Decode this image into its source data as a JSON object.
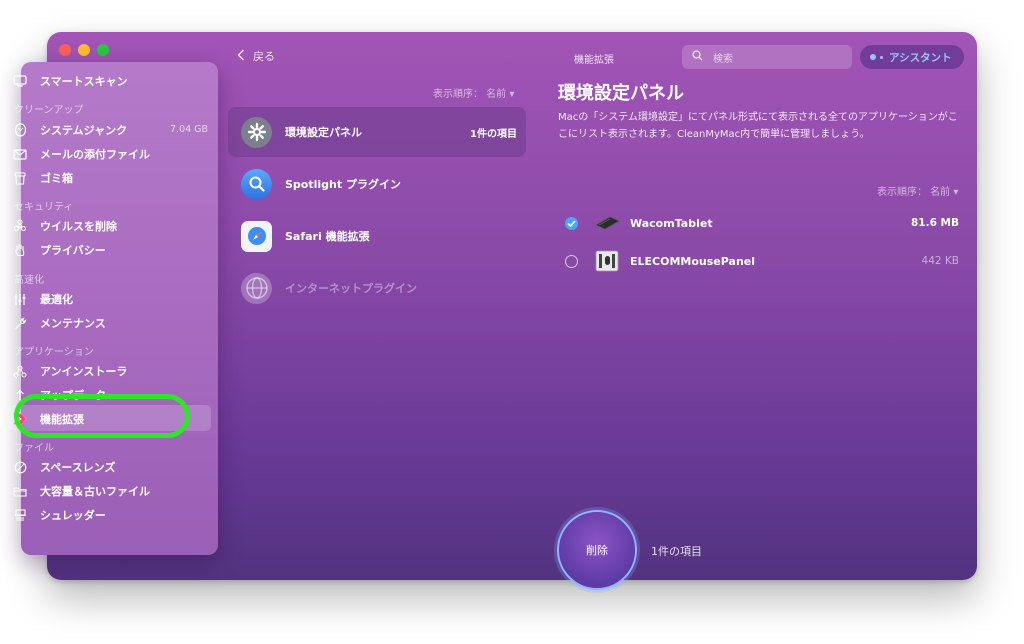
{
  "window": {
    "back_label": "戻る",
    "title": "機能拡張",
    "search_placeholder": "検索",
    "assistant_label": "アシスタント"
  },
  "sidebar": {
    "smart_scan": "スマートスキャン",
    "sections": {
      "cleanup": "クリーンアップ",
      "security": "セキュリティ",
      "speed": "高速化",
      "apps": "アプリケーション",
      "files": "ファイル"
    },
    "items": {
      "system_junk": "システムジャンク",
      "system_junk_size": "7.04 GB",
      "mail_attachments": "メールの添付ファイル",
      "trash": "ゴミ箱",
      "malware": "ウイルスを削除",
      "privacy": "プライバシー",
      "optimization": "最適化",
      "maintenance": "メンテナンス",
      "uninstaller": "アンインストーラ",
      "updater": "アップデータ",
      "extensions": "機能拡張",
      "space_lens": "スペースレンズ",
      "large_old": "大容量＆古いファイル",
      "shredder": "シュレッダー"
    }
  },
  "middle": {
    "sort_label": "表示順序： 名前",
    "categories": [
      {
        "label": "環境設定パネル",
        "count": "1件の項目"
      },
      {
        "label": "Spotlight プラグイン"
      },
      {
        "label": "Safari 機能拡張"
      },
      {
        "label": "インターネットプラグイン"
      }
    ]
  },
  "panel": {
    "title": "環境設定パネル",
    "description": "Macの「システム環境設定」にてパネル形式にて表示される全てのアプリケーションがここにリスト表示されます。CleanMyMac内で簡単に管理しましょう。",
    "sort_label": "表示順序： 名前",
    "apps": [
      {
        "name": "WacomTablet",
        "size": "81.6 MB"
      },
      {
        "name": "ELECOMMousePanel",
        "size": "442 KB"
      }
    ]
  },
  "footer": {
    "delete_label": "削除",
    "selected_count": "1件の項目"
  },
  "colors": {
    "highlight": "#2ee628",
    "accent_blue": "#4aa5ff"
  }
}
